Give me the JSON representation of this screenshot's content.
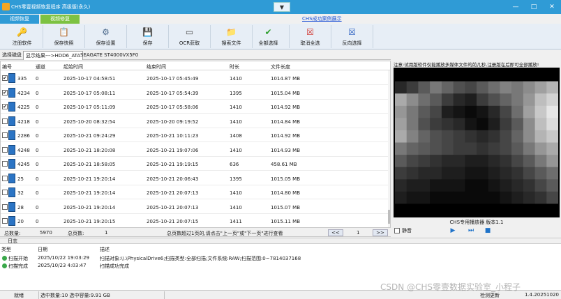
{
  "window": {
    "title": "CHS零壹视频恢复程序 高级版(永久)",
    "collapse_glyph": "▼",
    "minimize_glyph": "—",
    "maximize_glyph": "□",
    "close_glyph": "✕"
  },
  "top_tabs": [
    {
      "label": "视频恢复"
    },
    {
      "label": "视频修复"
    }
  ],
  "demo_link": "CHS成功案例展示",
  "toolbar": [
    {
      "label": "注册软件",
      "icon": "key-icon",
      "glyph": "🔑"
    },
    {
      "label": "保存快照",
      "icon": "snapshot-icon",
      "glyph": "📋"
    },
    {
      "label": "保存设置",
      "icon": "settings-save-icon",
      "glyph": "⚙"
    },
    {
      "label": "保存",
      "icon": "save-icon",
      "glyph": "💾"
    },
    {
      "label": "OCR获取",
      "icon": "ocr-icon",
      "glyph": "▭"
    },
    {
      "label": "搜索文件",
      "icon": "search-file-icon",
      "glyph": "📁"
    },
    {
      "label": "全部选择",
      "icon": "check-icon",
      "glyph": "✔"
    },
    {
      "label": "取消全选",
      "icon": "uncheck-icon",
      "glyph": "☒"
    },
    {
      "label": "反向选择",
      "icon": "invert-icon",
      "glyph": "☒"
    }
  ],
  "disk_tabs": [
    {
      "label": "选择磁盘"
    },
    {
      "label": "显示结果--->HDD6_ATA"
    },
    {
      "label": "SEAGATE ST4000VX5F0"
    }
  ],
  "grid": {
    "columns": [
      "编号",
      "通道",
      "起始时间",
      "结束时间",
      "时长",
      "文件长度"
    ],
    "rows": [
      {
        "id": "335",
        "channel": "0",
        "start": "2025-10-17 04:58:51",
        "end": "2025-10-17 05:45:49",
        "duration": "1410",
        "size": "1014.87 MB",
        "checked": true
      },
      {
        "id": "4234",
        "channel": "0",
        "start": "2025-10-17 05:08:11",
        "end": "2025-10-17 05:54:39",
        "duration": "1395",
        "size": "1015.04 MB",
        "checked": true
      },
      {
        "id": "4225",
        "channel": "0",
        "start": "2025-10-17 05:11:09",
        "end": "2025-10-17 05:58:06",
        "duration": "1410",
        "size": "1014.92 MB",
        "checked": true
      },
      {
        "id": "4218",
        "channel": "0",
        "start": "2025-10-20 08:32:54",
        "end": "2025-10-20 09:19:52",
        "duration": "1410",
        "size": "1014.84 MB",
        "checked": false
      },
      {
        "id": "2286",
        "channel": "0",
        "start": "2025-10-21 09:24:29",
        "end": "2025-10-21 10:11:23",
        "duration": "1408",
        "size": "1014.92 MB",
        "checked": false
      },
      {
        "id": "4248",
        "channel": "0",
        "start": "2025-10-21 18:20:08",
        "end": "2025-10-21 19:07:06",
        "duration": "1410",
        "size": "1014.93 MB",
        "checked": false
      },
      {
        "id": "4245",
        "channel": "0",
        "start": "2025-10-21 18:58:05",
        "end": "2025-10-21 19:19:15",
        "duration": "636",
        "size": "458.61 MB",
        "checked": false
      },
      {
        "id": "25",
        "channel": "0",
        "start": "2025-10-21 19:20:14",
        "end": "2025-10-21 20:06:43",
        "duration": "1395",
        "size": "1015.05 MB",
        "checked": false
      },
      {
        "id": "32",
        "channel": "0",
        "start": "2025-10-21 19:20:14",
        "end": "2025-10-21 20:07:13",
        "duration": "1410",
        "size": "1014.80 MB",
        "checked": false
      },
      {
        "id": "28",
        "channel": "0",
        "start": "2025-10-21 19:20:14",
        "end": "2025-10-21 20:07:13",
        "duration": "1410",
        "size": "1015.07 MB",
        "checked": false
      },
      {
        "id": "20",
        "channel": "0",
        "start": "2025-10-21 19:20:15",
        "end": "2025-10-21 20:07:15",
        "duration": "1411",
        "size": "1015.11 MB",
        "checked": false
      }
    ]
  },
  "pager": {
    "total_label": "总数量:",
    "total_value": "5970",
    "pages_label": "总页数:",
    "pages_value": "1",
    "hint": "总页数超过1页的,请点击\"上一页\"或\"下一页\"进行查看",
    "prev": "<<",
    "current": "1",
    "next": ">>"
  },
  "notice": "注意:试用版软件仅能播放多媒体文件的前几秒,注册版在后即可全部播放!",
  "player": {
    "title": "CHS专用播放器 版本1.1",
    "mute_label": "静音",
    "play_glyph": "▶",
    "next_glyph": "⏭",
    "stop_glyph": "■"
  },
  "log": {
    "title": "日志",
    "columns": [
      "类型",
      "日期",
      "描述"
    ],
    "entries": [
      {
        "type": "扫描开始",
        "date": "2025/10/22 19:03:29",
        "desc": "扫描对象:\\\\.\\PhysicalDrive6;扫描类型:全部扫描;文件系统:RAW;扫描范围:0~7814037168"
      },
      {
        "type": "扫描完成",
        "date": "2025/10/23 4:03:47",
        "desc": "扫描成功完成"
      }
    ]
  },
  "statusbar": {
    "state": "就绪",
    "selection": "选中数量:10 选中容量:9.91 GB",
    "update": "检测更新",
    "version": "1.4.20251020"
  },
  "watermark": "CSDN @CHS零壹数据实验室_小程子"
}
